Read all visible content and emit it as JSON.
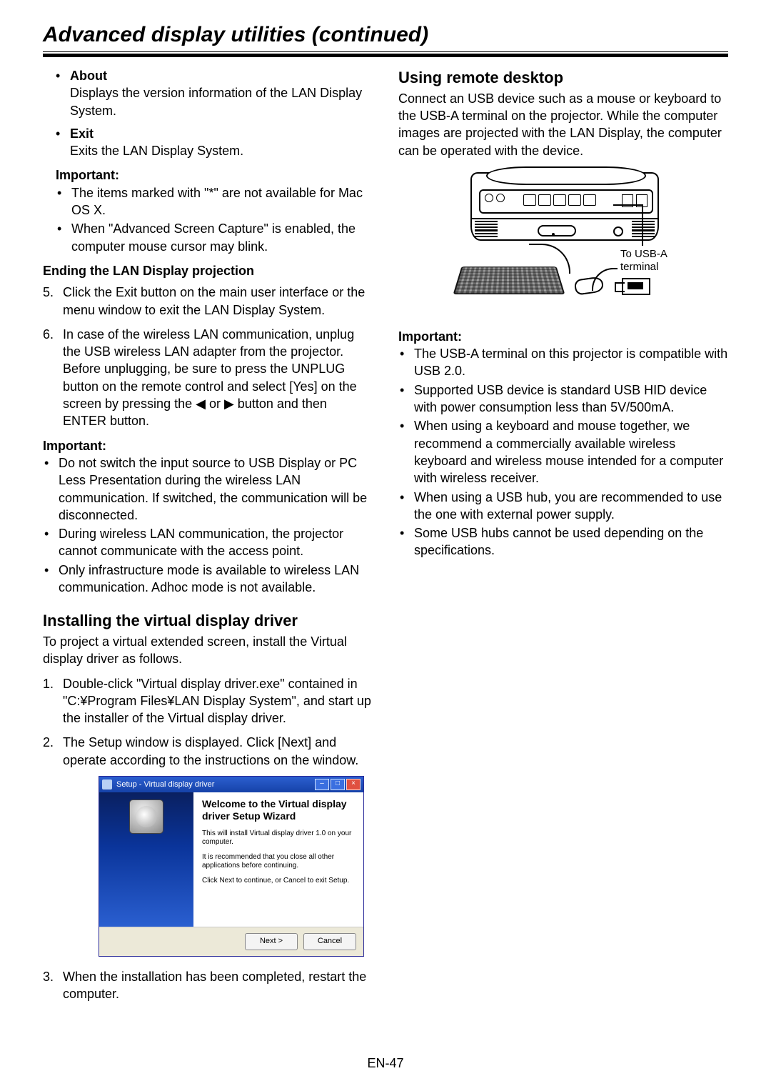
{
  "section_title": "Advanced display utilities (continued)",
  "left": {
    "about_label": "About",
    "about_text": "Displays the version information of the  LAN Display System.",
    "exit_label": "Exit",
    "exit_text": "Exits the LAN Display System.",
    "important1_label": "Important:",
    "important1_items": [
      "The items marked with \"*\" are not available for Mac OS X.",
      "When \"Advanced Screen Capture\" is enabled, the computer mouse cursor may blink."
    ],
    "ending_heading": "Ending the LAN Display projection",
    "ending_items": [
      {
        "num": "5.",
        "text": "Click the Exit button on the main user interface or the menu window to exit the LAN Display System."
      },
      {
        "num": "6.",
        "text": "In case of the wireless LAN communication, unplug the USB wireless LAN adapter from the projector. Before unplugging, be sure to press the UNPLUG button on the remote control and select [Yes] on the screen by pressing the ◀ or ▶ button and then ENTER button."
      }
    ],
    "important2_label": "Important:",
    "important2_items": [
      "Do not switch the input source to USB Display or PC Less Presentation during the wireless LAN communication. If switched, the communication will be disconnected.",
      "During wireless LAN communication, the projector cannot communicate with the access point.",
      "Only infrastructure mode is available to wireless LAN communication. Adhoc mode is not available."
    ],
    "install_heading": "Installing the virtual display driver",
    "install_intro": "To project a virtual extended screen, install the Virtual display driver as follows.",
    "install_steps": [
      {
        "num": "1.",
        "text": "Double-click \"Virtual display driver.exe\" contained in \"C:¥Program Files¥LAN Display System\", and start up the installer of the Virtual display driver."
      },
      {
        "num": "2.",
        "text": "The Setup window is displayed. Click [Next] and operate according to the instructions on the window."
      }
    ],
    "install_step3": {
      "num": "3.",
      "text": "When the installation has been completed, restart the computer."
    },
    "dialog": {
      "title": "Setup - Virtual display driver",
      "welcome": "Welcome to the Virtual display driver Setup Wizard",
      "line1": "This will install Virtual display driver 1.0 on your computer.",
      "line2": "It is recommended that you close all other applications before continuing.",
      "line3": "Click Next to continue, or Cancel to exit Setup.",
      "next": "Next >",
      "cancel": "Cancel"
    }
  },
  "right": {
    "heading": "Using remote desktop",
    "intro": "Connect an USB device such as a mouse or keyboard to the USB-A terminal on the projector. While the computer images are projected with the LAN Display, the computer can be operated with the device.",
    "port_label_1": "To USB-A",
    "port_label_2": "terminal",
    "important_label": "Important:",
    "important_items": [
      "The USB-A terminal on this projector is compatible with USB 2.0.",
      "Supported USB device is standard USB HID device with power consumption less than 5V/500mA.",
      "When using a keyboard and mouse together, we recommend a commercially available wireless keyboard and wireless mouse intended for a computer with wireless receiver.",
      "When using a USB hub, you are recommended to use the one with external power supply.",
      "Some USB hubs cannot be used depending on the specifications."
    ]
  },
  "page_number": "EN-47"
}
